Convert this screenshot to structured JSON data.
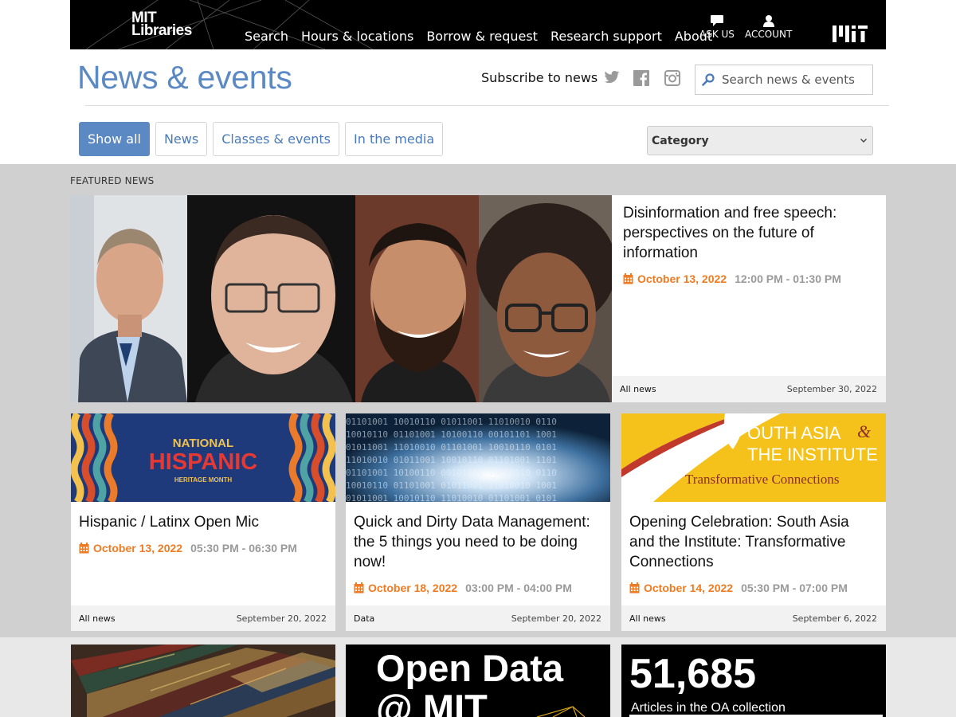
{
  "header": {
    "logo_line1": "MIT",
    "logo_line2": "Libraries",
    "nav": [
      "Search",
      "Hours & locations",
      "Borrow & request",
      "Research support",
      "About"
    ],
    "ask_us": "ASK US",
    "account": "ACCOUNT"
  },
  "page": {
    "title": "News & events",
    "subscribe": "Subscribe to news",
    "search_placeholder": "Search news & events"
  },
  "filters": {
    "items": [
      "Show all",
      "News",
      "Classes & events",
      "In the media"
    ],
    "active": "Show all",
    "category_label": "Category"
  },
  "featured": {
    "label": "FEATURED NEWS",
    "title": "Disinformation and free speech: perspectives on the future of information",
    "date": "October 13, 2022",
    "time": "12:00 PM - 01:30 PM",
    "category": "All news",
    "posted": "September 30, 2022"
  },
  "cards": [
    {
      "title": "Hispanic / Latinx Open Mic",
      "date": "October 13, 2022",
      "time": "05:30 PM - 06:30 PM",
      "category": "All news",
      "posted": "September 20, 2022",
      "img_line1": "NATIONAL",
      "img_line2": "HISPANIC",
      "img_line3": "HERITAGE MONTH"
    },
    {
      "title": "Quick and Dirty Data Management: the 5 things you need to be doing now!",
      "date": "October 18, 2022",
      "time": "03:00 PM - 04:00 PM",
      "category": "Data",
      "posted": "September 20, 2022"
    },
    {
      "title": "Opening Celebration: South Asia and the Institute: Transformative Connections",
      "date": "October 14, 2022",
      "time": "05:30 PM - 07:00 PM",
      "category": "All news",
      "posted": "September 6, 2022",
      "img_line1": "OUTH ASIA",
      "img_amp": "&",
      "img_line2": "THE INSTITUTE",
      "img_line3": "Transformative Connections"
    }
  ],
  "bottom": {
    "open_data_line1": "Open Data",
    "open_data_line2": "@ MIT",
    "stat_number": "51,685",
    "stat_label": "Articles in the OA collection"
  },
  "colors": {
    "brand_blue": "#5b89c4",
    "date_orange": "#ef7b22",
    "header_bg": "#000000",
    "section_gray": "#d0d0d0"
  }
}
